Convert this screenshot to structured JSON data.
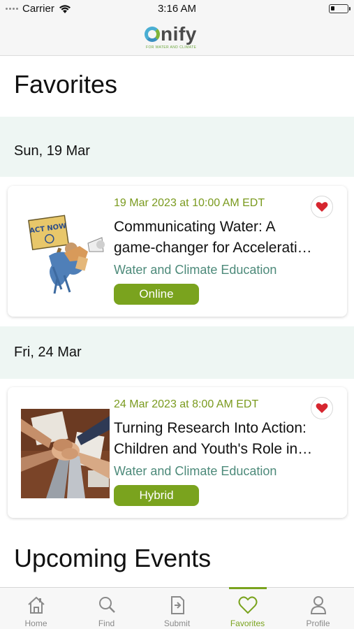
{
  "status_bar": {
    "carrier": "Carrier",
    "time": "3:16 AM"
  },
  "header": {
    "logo_text": "nify",
    "logo_tagline": "FOR WATER AND CLIMATE"
  },
  "page_title": "Favorites",
  "groups": [
    {
      "date_label": "Sun, 19 Mar",
      "event": {
        "datetime": "19 Mar 2023 at 10:00 AM EDT",
        "title_line1": "Communicating Water: A",
        "title_line2": "game-changer for Accelerati…",
        "category": "Water and Climate Education",
        "badge": "Online",
        "image_sign_text": "ACT NOW",
        "favorite_icon": "heart-filled-icon"
      }
    },
    {
      "date_label": "Fri, 24 Mar",
      "event": {
        "datetime": "24 Mar 2023 at 8:00 AM EDT",
        "title_line1": "Turning Research Into Action:",
        "title_line2": "Children and Youth's Role in…",
        "category": "Water and Climate Education",
        "badge": "Hybrid",
        "favorite_icon": "heart-filled-icon"
      }
    }
  ],
  "upcoming_title": "Upcoming Events",
  "tab_bar": {
    "active": "Favorites",
    "tabs": [
      {
        "label": "Home",
        "icon": "home-icon"
      },
      {
        "label": "Find",
        "icon": "search-icon"
      },
      {
        "label": "Submit",
        "icon": "submit-doc-icon"
      },
      {
        "label": "Favorites",
        "icon": "heart-icon"
      },
      {
        "label": "Profile",
        "icon": "person-icon"
      }
    ]
  },
  "colors": {
    "accent": "#7aa31e",
    "category_text": "#4d8a7a",
    "date_band": "#eef6f3",
    "heart": "#d6262f"
  }
}
